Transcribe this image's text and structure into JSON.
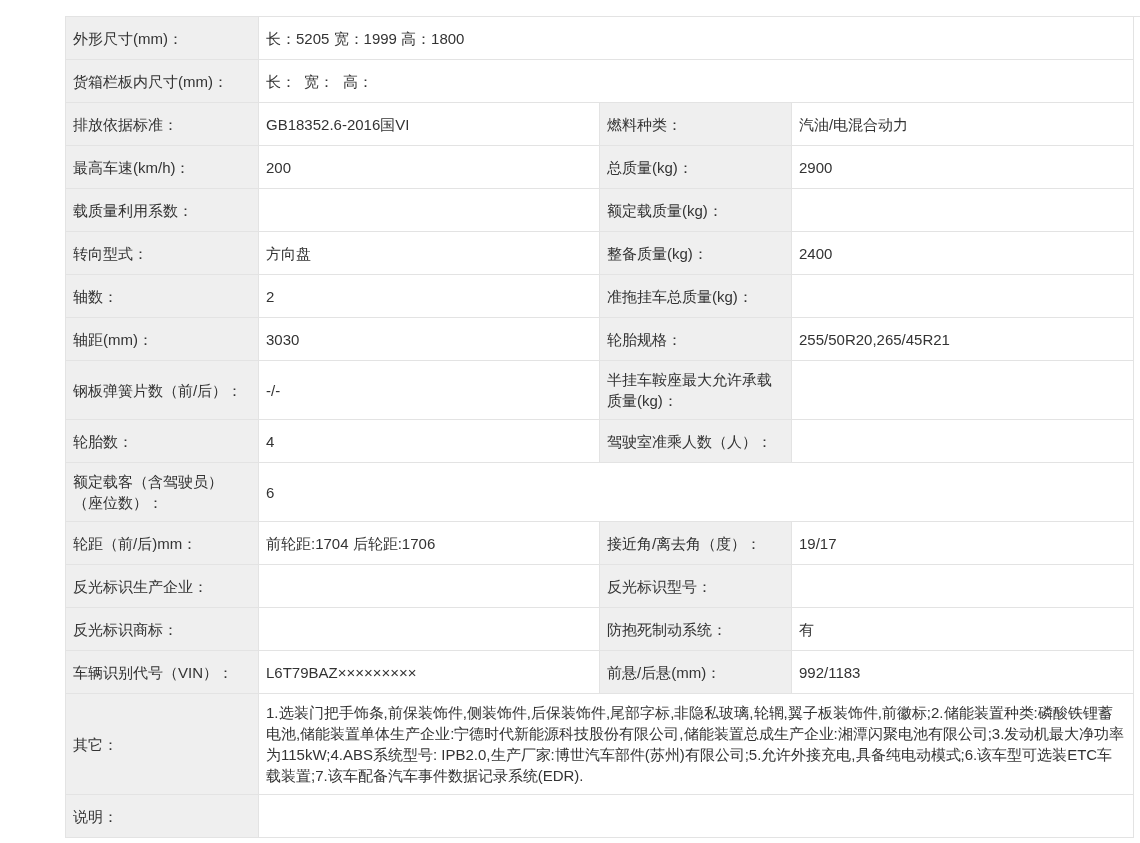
{
  "spec_table": {
    "rows": [
      {
        "kind": "full",
        "label": "外形尺寸(mm)：",
        "value": "长：5205 宽：1999 高：1800"
      },
      {
        "kind": "full",
        "label": "货箱栏板内尺寸(mm)：",
        "value": "长：  宽：  高："
      },
      {
        "kind": "pair",
        "label": "排放依据标准：",
        "value": "GB18352.6-2016国VI",
        "label_2": "燃料种类：",
        "value_2": "汽油/电混合动力"
      },
      {
        "kind": "pair",
        "label": "最高车速(km/h)：",
        "value": "200",
        "label_2": "总质量(kg)：",
        "value_2": "2900"
      },
      {
        "kind": "pair",
        "label": "载质量利用系数：",
        "label_2": "额定载质量(kg)："
      },
      {
        "kind": "pair",
        "label": "转向型式：",
        "value": "方向盘",
        "label_2": "整备质量(kg)：",
        "value_2": "2400"
      },
      {
        "kind": "pair",
        "label": "轴数：",
        "value": "2",
        "label_2": "准拖挂车总质量(kg)："
      },
      {
        "kind": "pair",
        "label": "轴距(mm)：",
        "value": "3030",
        "label_2": "轮胎规格：",
        "value_2": "255/50R20,265/45R21"
      },
      {
        "kind": "pair",
        "label": "钢板弹簧片数（前/后）：",
        "value": "-/-",
        "label_2": "半挂车鞍座最大允许承载质量(kg)："
      },
      {
        "kind": "pair",
        "label": "轮胎数：",
        "value": "4",
        "label_2": "驾驶室准乘人数（人）："
      },
      {
        "kind": "full",
        "label": "额定载客（含驾驶员）（座位数）：",
        "value": "6"
      },
      {
        "kind": "pair",
        "label": "轮距（前/后)mm：",
        "value": "前轮距:1704 后轮距:1706",
        "label_2": "接近角/离去角（度）：",
        "value_2": "19/17"
      },
      {
        "kind": "pair",
        "label": "反光标识生产企业：",
        "label_2": "反光标识型号："
      },
      {
        "kind": "pair",
        "label": "反光标识商标：",
        "label_2": "防抱死制动系统：",
        "value_2": "有"
      },
      {
        "kind": "pair",
        "label": "车辆识别代号（VIN）：",
        "value": "L6T79BAZ×××××××××",
        "label_2": "前悬/后悬(mm)：",
        "value_2": "992/1183"
      },
      {
        "kind": "full",
        "label": "其它：",
        "value": "1.选装门把手饰条,前保装饰件,侧装饰件,后保装饰件,尾部字标,非隐私玻璃,轮辋,翼子板装饰件,前徽标;2.储能装置种类:磷酸铁锂蓄电池,储能装置单体生产企业:宁德时代新能源科技股份有限公司,储能装置总成生产企业:湘潭闪聚电池有限公司;3.发动机最大净功率为115kW;4.ABS系统型号: IPB2.0,生产厂家:博世汽车部件(苏州)有限公司;5.允许外接充电,具备纯电动模式;6.该车型可选装ETC车载装置;7.该车配备汽车事件数据记录系统(EDR)."
      },
      {
        "kind": "full",
        "label": "说明："
      }
    ]
  }
}
